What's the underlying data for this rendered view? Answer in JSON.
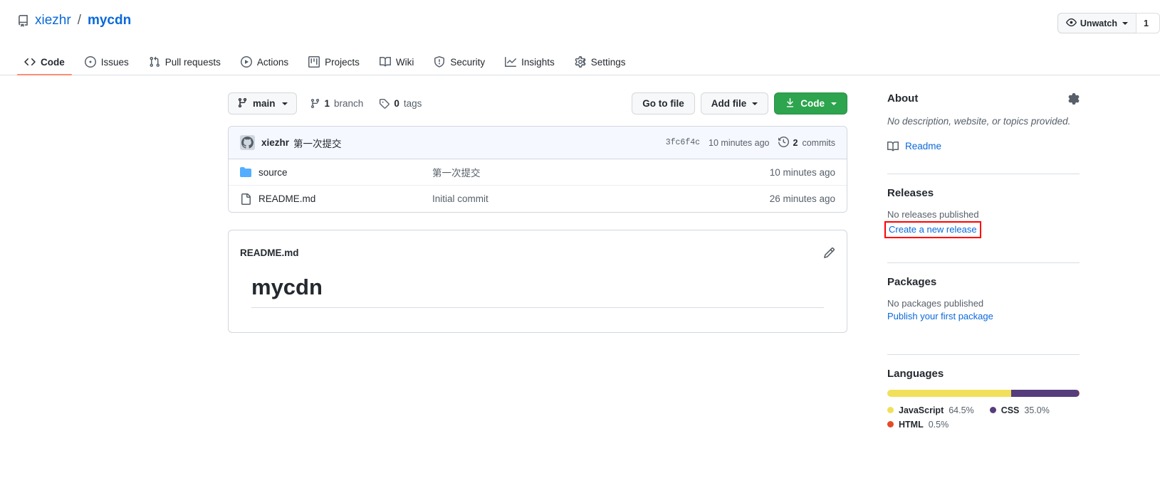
{
  "header": {
    "repo_icon": "repo-icon",
    "owner": "xiezhr",
    "separator": "/",
    "name": "mycdn",
    "watch_label": "Unwatch",
    "watch_icon": "eye-icon",
    "watch_count": "1"
  },
  "nav": {
    "tabs": [
      {
        "label": "Code",
        "icon": "code-icon",
        "selected": true
      },
      {
        "label": "Issues",
        "icon": "issue-opened-icon",
        "selected": false
      },
      {
        "label": "Pull requests",
        "icon": "git-pull-request-icon",
        "selected": false
      },
      {
        "label": "Actions",
        "icon": "play-icon",
        "selected": false
      },
      {
        "label": "Projects",
        "icon": "project-icon",
        "selected": false
      },
      {
        "label": "Wiki",
        "icon": "book-icon",
        "selected": false
      },
      {
        "label": "Security",
        "icon": "shield-icon",
        "selected": false
      },
      {
        "label": "Insights",
        "icon": "graph-icon",
        "selected": false
      },
      {
        "label": "Settings",
        "icon": "gear-icon",
        "selected": false
      }
    ]
  },
  "toolbar": {
    "branch": "main",
    "branch_icon": "git-branch-icon",
    "branches_count": "1",
    "branches_label": "branch",
    "tags_count": "0",
    "tags_label": "tags",
    "tag_icon": "tag-icon",
    "go_to_file": "Go to file",
    "add_file": "Add file",
    "code_button": "Code",
    "code_icon": "download-icon"
  },
  "commit_bar": {
    "avatar": "github-avatar",
    "author": "xiezhr",
    "message": "第一次提交",
    "sha": "3fc6f4c",
    "time": "10 minutes ago",
    "commits_count": "2",
    "commits_label": "commits",
    "history_icon": "history-icon"
  },
  "files": [
    {
      "icon": "folder-icon",
      "name": "source",
      "message": "第一次提交",
      "time": "10 minutes ago"
    },
    {
      "icon": "file-icon",
      "name": "README.md",
      "message": "Initial commit",
      "time": "26 minutes ago"
    }
  ],
  "readme": {
    "title": "README.md",
    "edit_icon": "pencil-icon",
    "heading": "mycdn"
  },
  "sidebar": {
    "about": {
      "title": "About",
      "gear_icon": "gear-icon",
      "description": "No description, website, or topics provided.",
      "readme_link": "Readme",
      "readme_icon": "book-icon"
    },
    "releases": {
      "title": "Releases",
      "empty_text": "No releases published",
      "create_link": "Create a new release",
      "highlighted": true,
      "highlight_color": "#ff0000"
    },
    "packages": {
      "title": "Packages",
      "empty_text": "No packages published",
      "publish_link": "Publish your first package"
    },
    "languages": {
      "title": "Languages",
      "items": [
        {
          "name": "JavaScript",
          "percent": "64.5%",
          "value": 64.5,
          "color": "#f1e05a"
        },
        {
          "name": "CSS",
          "percent": "35.0%",
          "value": 35.0,
          "color": "#563d7c"
        },
        {
          "name": "HTML",
          "percent": "0.5%",
          "value": 0.5,
          "color": "#e34c26"
        }
      ]
    }
  }
}
